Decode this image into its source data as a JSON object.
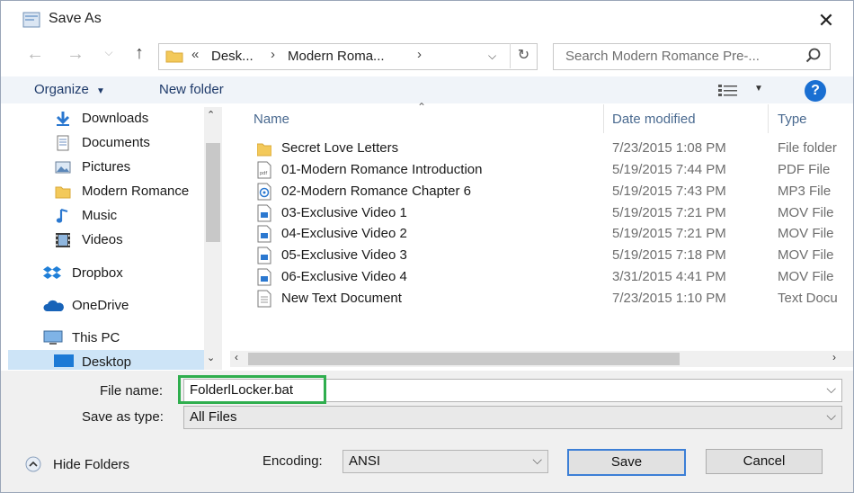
{
  "window": {
    "title": "Save As"
  },
  "address": {
    "prefix": "«",
    "segments": [
      "Desk...",
      "Modern Roma..."
    ]
  },
  "search": {
    "placeholder": "Search Modern Romance Pre-..."
  },
  "toolbar": {
    "organize": "Organize",
    "new_folder": "New folder",
    "help": "?"
  },
  "sidebar": {
    "items": [
      {
        "label": "Downloads",
        "icon": "download-arrow-icon",
        "pinned": true
      },
      {
        "label": "Documents",
        "icon": "documents-icon",
        "pinned": true
      },
      {
        "label": "Pictures",
        "icon": "pictures-icon",
        "pinned": true
      },
      {
        "label": "Modern Romance",
        "icon": "folder-icon",
        "pinned": false
      },
      {
        "label": "Music",
        "icon": "music-note-icon",
        "pinned": false
      },
      {
        "label": "Videos",
        "icon": "film-icon",
        "pinned": false
      },
      {
        "label": "Dropbox",
        "icon": "dropbox-icon",
        "pinned": false
      },
      {
        "label": "OneDrive",
        "icon": "cloud-icon",
        "pinned": false
      },
      {
        "label": "This PC",
        "icon": "computer-icon",
        "pinned": false
      },
      {
        "label": "Desktop",
        "icon": "desktop-icon",
        "pinned": false
      }
    ]
  },
  "columns": {
    "name": "Name",
    "date": "Date modified",
    "type": "Type"
  },
  "files": [
    {
      "name": "Secret Love Letters",
      "date": "7/23/2015 1:08 PM",
      "type": "File folder",
      "icon": "folder-icon"
    },
    {
      "name": "01-Modern Romance Introduction",
      "date": "5/19/2015 7:44 PM",
      "type": "PDF File",
      "icon": "pdf-icon"
    },
    {
      "name": "02-Modern Romance Chapter 6",
      "date": "5/19/2015 7:43 PM",
      "type": "MP3 File",
      "icon": "audio-file-icon"
    },
    {
      "name": "03-Exclusive Video 1",
      "date": "5/19/2015 7:21 PM",
      "type": "MOV File",
      "icon": "video-file-icon"
    },
    {
      "name": "04-Exclusive Video 2",
      "date": "5/19/2015 7:21 PM",
      "type": "MOV File",
      "icon": "video-file-icon"
    },
    {
      "name": "05-Exclusive Video 3",
      "date": "5/19/2015 7:18 PM",
      "type": "MOV File",
      "icon": "video-file-icon"
    },
    {
      "name": "06-Exclusive Video 4",
      "date": "3/31/2015 4:41 PM",
      "type": "MOV File",
      "icon": "video-file-icon"
    },
    {
      "name": "New Text Document",
      "date": "7/23/2015 1:10 PM",
      "type": "Text Docu",
      "icon": "text-file-icon"
    }
  ],
  "form": {
    "file_name_label": "File name:",
    "file_name_value": "FolderlLocker.bat",
    "save_as_type_label": "Save as type:",
    "save_as_type_value": "All Files",
    "encoding_label": "Encoding:",
    "encoding_value": "ANSI",
    "hide_folders": "Hide Folders",
    "save": "Save",
    "cancel": "Cancel"
  },
  "colors": {
    "accent": "#1a6fd2",
    "highlight_box": "#2fae4e",
    "folder": "#f3c95a"
  }
}
